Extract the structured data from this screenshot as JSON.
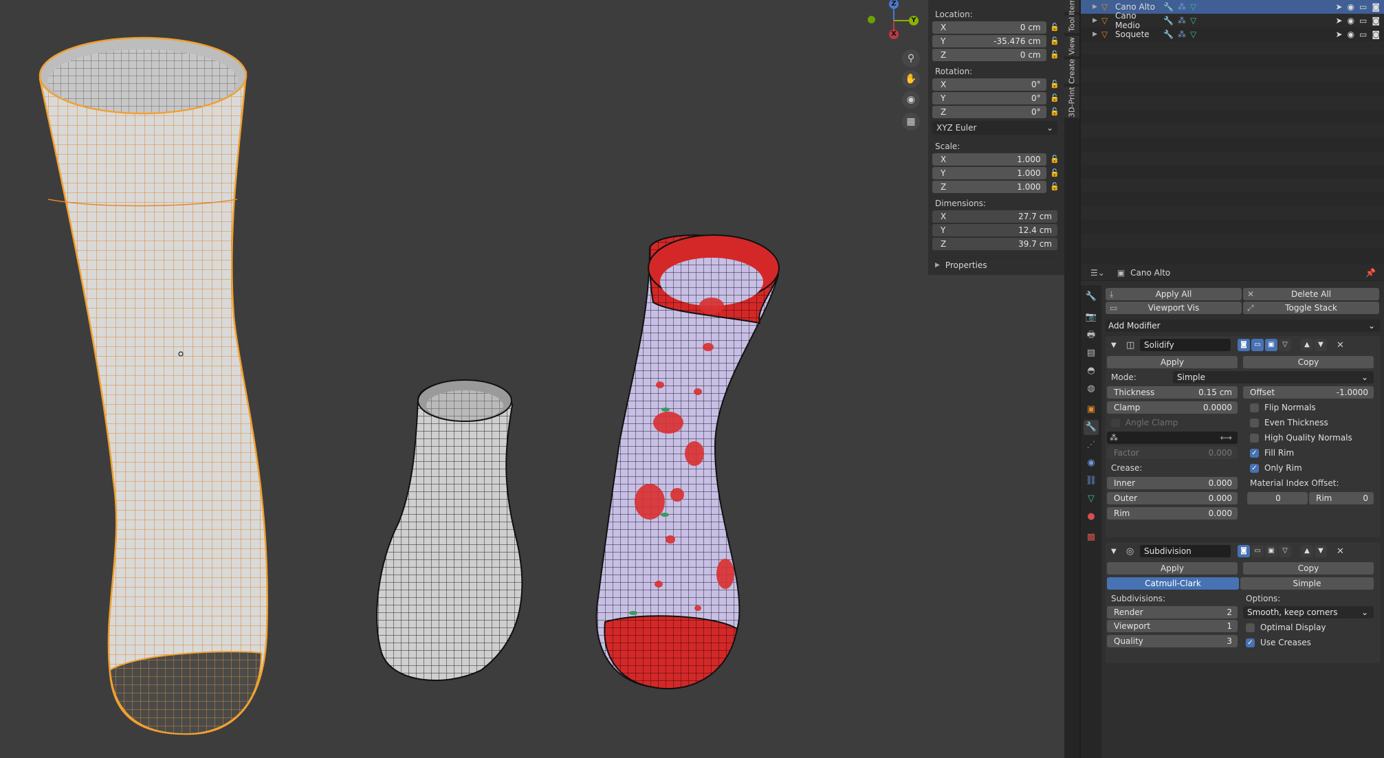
{
  "npanel": {
    "location_label": "Location:",
    "location": [
      {
        "axis": "X",
        "value": "0 cm"
      },
      {
        "axis": "Y",
        "value": "-35.476 cm"
      },
      {
        "axis": "Z",
        "value": "0 cm"
      }
    ],
    "rotation_label": "Rotation:",
    "rotation": [
      {
        "axis": "X",
        "value": "0°"
      },
      {
        "axis": "Y",
        "value": "0°"
      },
      {
        "axis": "Z",
        "value": "0°"
      }
    ],
    "rotation_mode": "XYZ Euler",
    "scale_label": "Scale:",
    "scale": [
      {
        "axis": "X",
        "value": "1.000"
      },
      {
        "axis": "Y",
        "value": "1.000"
      },
      {
        "axis": "Z",
        "value": "1.000"
      }
    ],
    "dimensions_label": "Dimensions:",
    "dimensions": [
      {
        "axis": "X",
        "value": "27.7 cm"
      },
      {
        "axis": "Y",
        "value": "12.4 cm"
      },
      {
        "axis": "Z",
        "value": "39.7 cm"
      }
    ],
    "properties_label": "Properties"
  },
  "gizmo": {
    "x": "X",
    "y": "Y",
    "z": "Z"
  },
  "vertical_tabs": [
    "Item",
    "Tool",
    "View",
    "Create",
    "3D-Print"
  ],
  "outliner": {
    "rows": [
      {
        "name": "Cano Alto",
        "selected": true
      },
      {
        "name": "Cano Medio",
        "selected": false
      },
      {
        "name": "Soquete",
        "selected": false
      }
    ]
  },
  "properties": {
    "object_name": "Cano Alto",
    "apply_all": "Apply All",
    "delete_all": "Delete All",
    "viewport_vis": "Viewport Vis",
    "toggle_stack": "Toggle Stack",
    "add_modifier": "Add Modifier",
    "solidify": {
      "name": "Solidify",
      "apply": "Apply",
      "copy": "Copy",
      "mode_label": "Mode:",
      "mode_value": "Simple",
      "thickness_label": "Thickness",
      "thickness_value": "0.15 cm",
      "offset_label": "Offset",
      "offset_value": "-1.0000",
      "clamp_label": "Clamp",
      "clamp_value": "0.0000",
      "angle_clamp": "Angle Clamp",
      "flip_normals": "Flip Normals",
      "even_thickness": "Even Thickness",
      "high_quality_normals": "High Quality Normals",
      "fill_rim": "Fill Rim",
      "only_rim": "Only Rim",
      "factor_label": "Factor",
      "factor_value": "0.000",
      "crease_label": "Crease:",
      "inner_label": "Inner",
      "inner_value": "0.000",
      "outer_label": "Outer",
      "outer_value": "0.000",
      "rim_label": "Rim",
      "rim_value": "0.000",
      "material_index_label": "Material Index Offset:",
      "mat_offset_value": "0",
      "mat_rim_label": "Rim",
      "mat_rim_value": "0"
    },
    "subdivision": {
      "name": "Subdivision",
      "apply": "Apply",
      "copy": "Copy",
      "catmull_clark": "Catmull-Clark",
      "simple": "Simple",
      "subdivisions_label": "Subdivisions:",
      "options_label": "Options:",
      "render_label": "Render",
      "render_value": "2",
      "viewport_label": "Viewport",
      "viewport_value": "1",
      "quality_label": "Quality",
      "quality_value": "3",
      "uv_mode": "Smooth, keep corners",
      "optimal_display": "Optimal Display",
      "use_creases": "Use Creases"
    }
  },
  "colors": {
    "selection_orange": "#f0a030",
    "sock_red": "#d42828",
    "sock_lavender": "#c8bfe6",
    "accent_blue": "#4772b3"
  }
}
